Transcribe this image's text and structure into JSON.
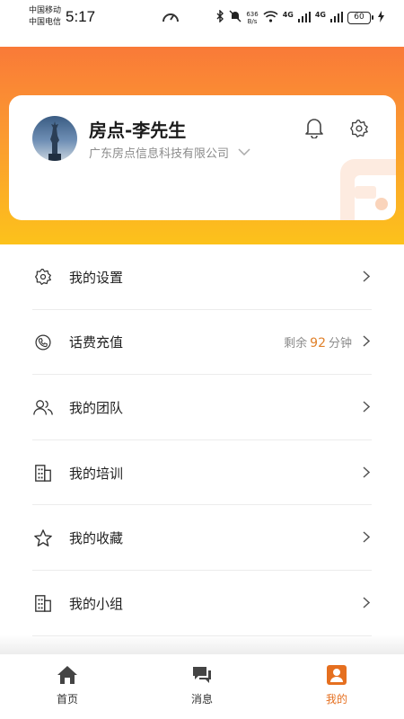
{
  "status_bar": {
    "carrier_1": "中国移动",
    "carrier_2": "中国电信",
    "time": "5:17",
    "net_speed_value": "636",
    "net_speed_unit": "B/s",
    "network_1": "4G",
    "network_2": "4G",
    "battery": "60"
  },
  "profile": {
    "name": "房点-李先生",
    "company": "广东房点信息科技有限公司"
  },
  "menu": [
    {
      "label": "我的设置",
      "icon": "gear-icon"
    },
    {
      "label": "话费充值",
      "icon": "phone-icon",
      "prefix": "剩余",
      "value": "92",
      "suffix": "分钟"
    },
    {
      "label": "我的团队",
      "icon": "team-icon"
    },
    {
      "label": "我的培训",
      "icon": "building-icon"
    },
    {
      "label": "我的收藏",
      "icon": "star-icon"
    },
    {
      "label": "我的小组",
      "icon": "building-icon"
    }
  ],
  "tabs": [
    {
      "label": "首页",
      "icon": "home-icon",
      "active": false
    },
    {
      "label": "消息",
      "icon": "message-icon",
      "active": false
    },
    {
      "label": "我的",
      "icon": "profile-icon",
      "active": true
    }
  ],
  "colors": {
    "accent": "#e56f1f",
    "gradient_top": "#f97a38",
    "gradient_bottom": "#fcc21b"
  }
}
